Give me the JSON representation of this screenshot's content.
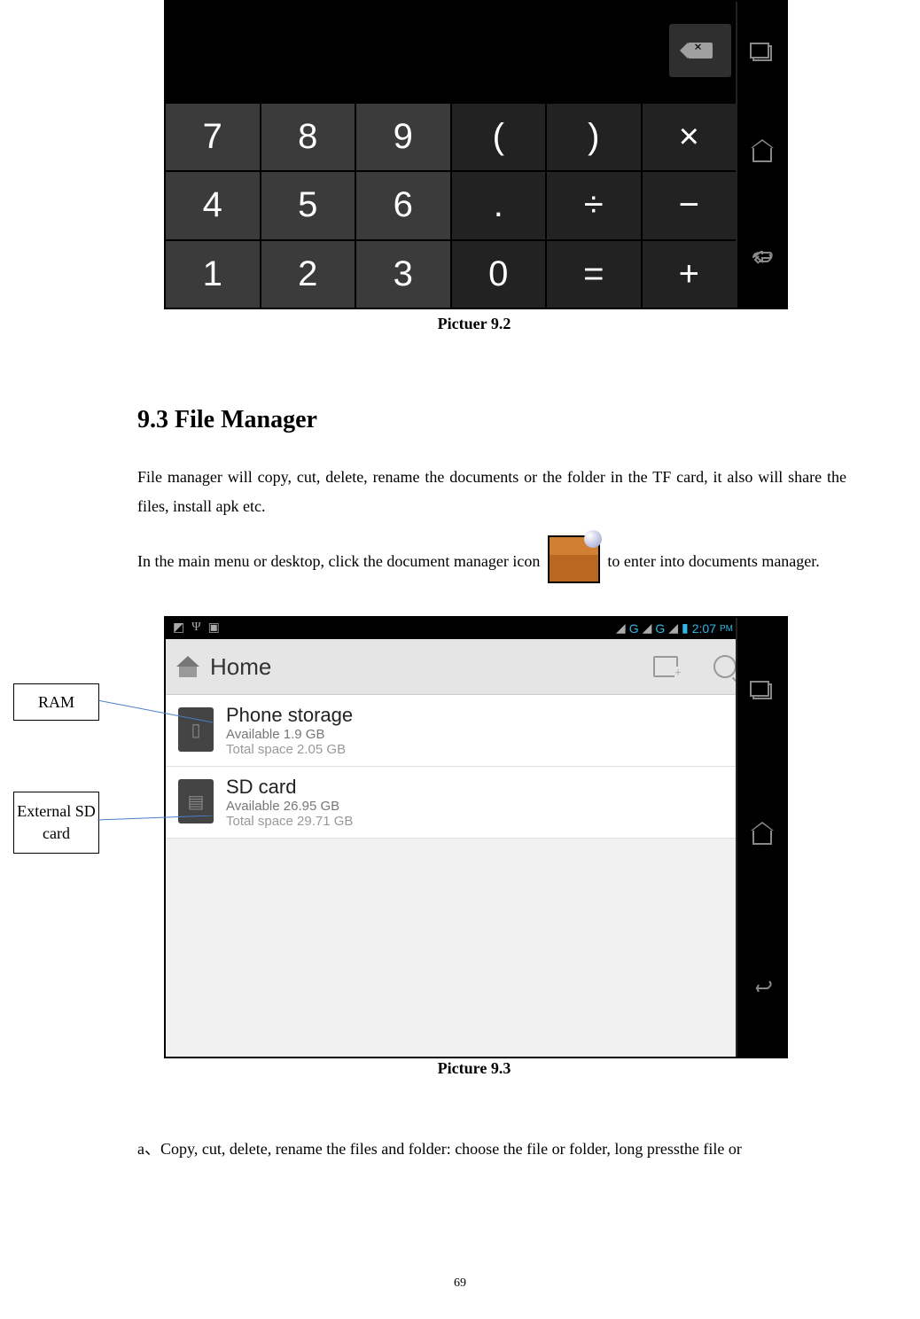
{
  "calculator": {
    "keys_row1": [
      "7",
      "8",
      "9",
      "(",
      ")",
      "×"
    ],
    "keys_row2": [
      "4",
      "5",
      "6",
      ".",
      "÷",
      "−"
    ],
    "keys_row3": [
      "1",
      "2",
      "3",
      "0",
      "=",
      "+"
    ],
    "caption": "Pictuer 9.2"
  },
  "section": {
    "heading": "9.3 File Manager",
    "para1": "File manager will copy, cut, delete, rename the documents or the folder in the TF card, it also will share the files, install apk etc.",
    "para2a": "In the main menu or desktop, click the document manager icon ",
    "para2b": " to enter into documents manager.",
    "para3": "a、Copy, cut, delete, rename the files and folder: choose the file or folder, long pressthe file or"
  },
  "filemanager": {
    "status_time": "2:07",
    "status_ampm": "PM",
    "home_label": "Home",
    "phone": {
      "title": "Phone storage",
      "available": "Available 1.9 GB",
      "total": "Total space 2.05 GB"
    },
    "sd": {
      "title": "SD card",
      "available": "Available 26.95 GB",
      "total": "Total space 29.71 GB"
    },
    "caption": "Picture 9.3"
  },
  "annotations": {
    "ram": "RAM",
    "sd": "External SD card"
  },
  "pagenum": "69"
}
